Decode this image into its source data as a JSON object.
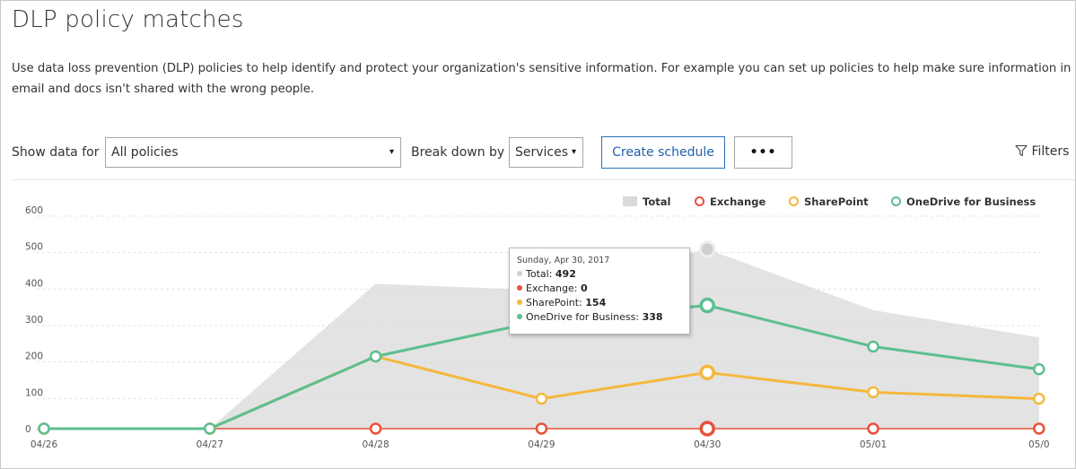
{
  "page": {
    "title": "DLP policy matches",
    "description": "Use data loss prevention (DLP) policies to help identify and protect your organization's sensitive information. For example you can set up policies to help make sure information in email and docs isn't shared with the wrong people."
  },
  "toolbar": {
    "show_data_label": "Show data for",
    "show_data_value": "All policies",
    "break_down_label": "Break down by",
    "break_down_value": "Services",
    "create_schedule_label": "Create schedule",
    "more_label": "•••",
    "filters_label": "Filters",
    "filter_icon": "filter-icon",
    "caret_icon": "▾"
  },
  "legend": [
    {
      "name": "Total",
      "color": "#d9d9d9",
      "icon": "square"
    },
    {
      "name": "Exchange",
      "color": "#e8503a",
      "icon": "ring"
    },
    {
      "name": "SharePoint",
      "color": "#f5b83d",
      "icon": "ring"
    },
    {
      "name": "OneDrive for Business",
      "color": "#5cbf8f",
      "icon": "ring"
    }
  ],
  "tooltip": {
    "date": "Sunday, Apr 30, 2017",
    "rows": [
      {
        "label": "Total",
        "value": "492",
        "color": "#d0d0d0"
      },
      {
        "label": "Exchange",
        "value": "0",
        "color": "#e8503a"
      },
      {
        "label": "SharePoint",
        "value": "154",
        "color": "#f5b83d"
      },
      {
        "label": "OneDrive for Business",
        "value": "338",
        "color": "#5cbf8f"
      }
    ]
  },
  "chart_data": {
    "type": "line",
    "x": [
      "04/26",
      "04/27",
      "04/28",
      "04/29",
      "04/30",
      "05/01",
      "05/0"
    ],
    "yticks": [
      "600",
      "500",
      "400",
      "300",
      "200",
      "100",
      "0"
    ],
    "ylim": [
      0,
      600
    ],
    "grid": true,
    "legend_position": "top-right",
    "series": [
      {
        "name": "Total",
        "type": "area",
        "color": "#d9d9d9",
        "values": [
          0,
          0,
          397,
          380,
          492,
          325,
          250
        ]
      },
      {
        "name": "Exchange",
        "color": "#e8503a",
        "values": [
          0,
          0,
          0,
          0,
          0,
          0,
          0
        ]
      },
      {
        "name": "SharePoint",
        "color": "#f5b83d",
        "values": [
          0,
          0,
          198,
          82,
          154,
          100,
          82
        ]
      },
      {
        "name": "OneDrive for Business",
        "color": "#5cbf8f",
        "values": [
          0,
          0,
          198,
          296,
          338,
          225,
          163
        ]
      }
    ]
  }
}
